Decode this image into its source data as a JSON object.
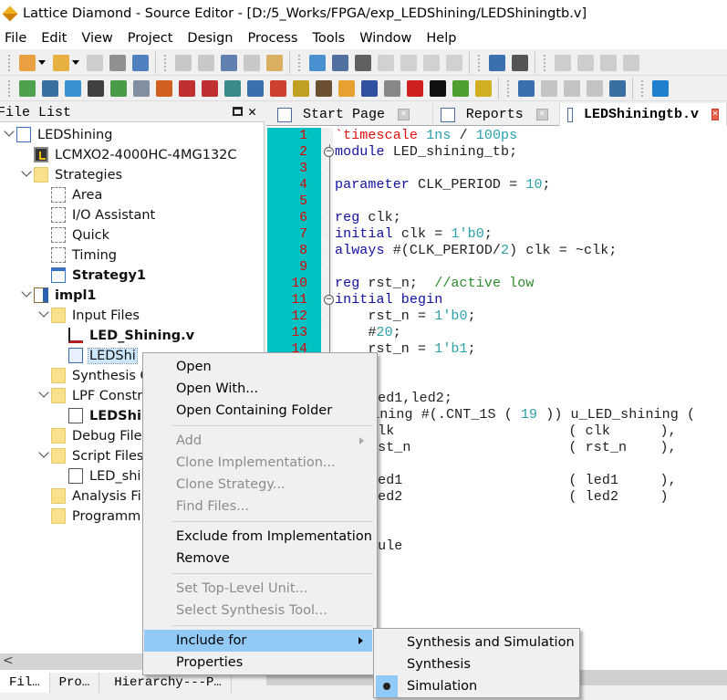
{
  "window": {
    "title": "Lattice Diamond - Source Editor - [D:/5_Works/FPGA/exp_LEDShining/LEDShiningtb.v]"
  },
  "menubar": [
    "File",
    "Edit",
    "View",
    "Project",
    "Design",
    "Process",
    "Tools",
    "Window",
    "Help"
  ],
  "toolbar1": [
    [
      "new-file-icon|#e8a040",
      "dropdown",
      "open-folder-icon|#e8b040",
      "dropdown",
      "save-icon|#b0b0b0",
      "save-all-icon|#909090",
      "print-icon|#5080c0"
    ],
    [
      "undo-icon|#a8a8a8",
      "redo-icon|#a8a8a8",
      "cut-icon|#6080b0",
      "copy-icon|#c8c8c8",
      "paste-icon|#d8b060"
    ],
    [
      "start-page-icon|#4a90d0",
      "report-icon|#5070a0",
      "find-icon|#606060",
      "zoom-in-icon|#b8b8b8",
      "zoom-out-icon|#b8b8b8",
      "zoom-fit-icon|#b8b8b8",
      "zoom-area-icon|#b8b8b8"
    ],
    [
      "strategy-icon|#3a70b0",
      "device-icon|#555555"
    ],
    [
      "run-icon|#b0b0b0",
      "rerun-icon|#b0b0b0",
      "rerun-all-icon|#b0b0b0",
      "stop-icon|#b0b0b0"
    ]
  ],
  "toolbar2": [
    [
      "edit-star-icon|#50a050",
      "spreadsheet-icon|#3a70a0",
      "chip-icon|#3a90d0",
      "netlist-analyzer-icon|#404040",
      "floorplan-icon|#4a9a4a",
      "package-icon|#8090a0",
      "physical-view-icon|#d06020",
      "waveform-icon|#c03030",
      "reveal-icon|#c03030",
      "ipexpress-icon|#3a8a8a",
      "timing-icon|#3a70b0",
      "power-icon|#d04030",
      "simulation-icon|#c0a020",
      "chip-brown-icon|#6a5030",
      "programmer-icon|#e8a030",
      "synplify-icon|#3050a0",
      "tools-icon|#888888",
      "sync-icon|#d02020",
      "modelsim-icon|#101010",
      "run-gear-icon|#50a030",
      "reveal-analyzer-icon|#d0b020"
    ],
    [
      "add-pane-icon|#3a70b0",
      "split-icon|#a0a0a0",
      "next-pane-icon|#a0a0a0",
      "swap-icon|#a0a0a0",
      "merge-icon|#3a70a0"
    ],
    [
      "web-icon|#2080d0"
    ]
  ],
  "filelist": {
    "title": "File List",
    "rows": [
      {
        "label": "LEDShining",
        "level": 0,
        "icon": "project",
        "expanded": true
      },
      {
        "label": "LCMXO2-4000HC-4MG132C",
        "level": 1,
        "icon": "device"
      },
      {
        "label": "Strategies",
        "level": 1,
        "icon": "folder",
        "expanded": true
      },
      {
        "label": "Area",
        "level": 2,
        "icon": "strategy"
      },
      {
        "label": "I/O Assistant",
        "level": 2,
        "icon": "strategy"
      },
      {
        "label": "Quick",
        "level": 2,
        "icon": "strategy"
      },
      {
        "label": "Timing",
        "level": 2,
        "icon": "strategy"
      },
      {
        "label": "Strategy1",
        "level": 2,
        "icon": "strategy-active",
        "bold": true
      },
      {
        "label": "impl1",
        "level": 1,
        "icon": "impl",
        "bold": true,
        "expanded": true
      },
      {
        "label": "Input Files",
        "level": 2,
        "icon": "folder",
        "expanded": true
      },
      {
        "label": "LED_Shining.v",
        "level": 3,
        "icon": "verilog",
        "bold": true
      },
      {
        "label": "LEDShi",
        "level": 3,
        "icon": "waveform",
        "selected": true
      },
      {
        "label": "Synthesis C",
        "level": 2,
        "icon": "folder"
      },
      {
        "label": "LPF Constr",
        "level": 2,
        "icon": "folder",
        "expanded": true
      },
      {
        "label": "LEDShi",
        "level": 3,
        "icon": "doc",
        "bold": true
      },
      {
        "label": "Debug File",
        "level": 2,
        "icon": "folder"
      },
      {
        "label": "Script Files",
        "level": 2,
        "icon": "folder",
        "expanded": true
      },
      {
        "label": "LED_shi",
        "level": 3,
        "icon": "doc"
      },
      {
        "label": "Analysis Fil",
        "level": 2,
        "icon": "folder"
      },
      {
        "label": "Programm",
        "level": 2,
        "icon": "folder"
      }
    ],
    "bottom_tabs": [
      "Fil…",
      "Pro…",
      "Hierarchy---P…"
    ]
  },
  "editor": {
    "tabs": [
      {
        "label": "Start Page",
        "icon": "start-page-icon",
        "active": false
      },
      {
        "label": "Reports",
        "icon": "report-icon",
        "active": false
      },
      {
        "label": "LEDShiningtb.v",
        "icon": "edit-file-icon",
        "active": true
      }
    ],
    "line_numbers": [
      "1",
      "2",
      "3",
      "4",
      "5",
      "6",
      "7",
      "8",
      "9",
      "10",
      "11",
      "12",
      "13",
      "14"
    ],
    "folds": [
      2,
      11
    ],
    "lines": [
      [
        [
          "dir",
          "`timescale "
        ],
        [
          "num",
          "1ns"
        ],
        [
          "id",
          " / "
        ],
        [
          "num",
          "100ps"
        ]
      ],
      [
        [
          "kw",
          "module"
        ],
        [
          "id",
          " LED_shining_tb;"
        ]
      ],
      [],
      [
        [
          "kw",
          "parameter"
        ],
        [
          "id",
          " CLK_PERIOD = "
        ],
        [
          "num",
          "10"
        ],
        [
          "id",
          ";"
        ]
      ],
      [],
      [
        [
          "kw",
          "reg"
        ],
        [
          "id",
          " clk;"
        ]
      ],
      [
        [
          "kw",
          "initial"
        ],
        [
          "id",
          " clk = "
        ],
        [
          "num",
          "1'b0"
        ],
        [
          "id",
          ";"
        ]
      ],
      [
        [
          "kw",
          "always"
        ],
        [
          "id",
          " #(CLK_PERIOD/"
        ],
        [
          "num",
          "2"
        ],
        [
          "id",
          ") clk = ~clk;"
        ]
      ],
      [],
      [
        [
          "kw",
          "reg"
        ],
        [
          "id",
          " rst_n;  "
        ],
        [
          "cm",
          "//active low"
        ]
      ],
      [
        [
          "kw",
          "initial begin"
        ]
      ],
      [
        [
          "id",
          "    rst_n = "
        ],
        [
          "num",
          "1'b0"
        ],
        [
          "id",
          ";"
        ]
      ],
      [
        [
          "id",
          "    #"
        ],
        [
          "num",
          "20"
        ],
        [
          "id",
          ";"
        ]
      ],
      [
        [
          "id",
          "    rst_n = "
        ],
        [
          "num",
          "1'b1"
        ],
        [
          "id",
          ";"
        ]
      ]
    ],
    "partial_lines": [
      {
        "line": 17,
        "segs": [
          [
            "id",
            "led1,led2;"
          ]
        ]
      },
      {
        "line": 18,
        "segs": [
          [
            "id",
            "hining #(.CNT_1S ( "
          ],
          [
            "num",
            "19"
          ],
          [
            "id",
            " )) u_LED_shining ("
          ]
        ]
      },
      {
        "line": 19,
        "segs": [
          [
            "id",
            "clk                     ( clk      ),"
          ]
        ]
      },
      {
        "line": 20,
        "segs": [
          [
            "id",
            "rst_n                   ( rst_n    ),"
          ]
        ]
      },
      {
        "line": 22,
        "segs": [
          [
            "id",
            "led1                    ( led1     ),"
          ]
        ]
      },
      {
        "line": 23,
        "segs": [
          [
            "id",
            "led2                    ( led2     )"
          ]
        ]
      },
      {
        "line": 26,
        "segs": [
          [
            "id",
            "dule"
          ]
        ]
      }
    ]
  },
  "context_menu": {
    "items": [
      {
        "label": "Open"
      },
      {
        "label": "Open With..."
      },
      {
        "label": "Open Containing Folder"
      },
      {
        "sep": true
      },
      {
        "label": "Add",
        "disabled": true,
        "submenu": true
      },
      {
        "label": "Clone Implementation...",
        "disabled": true
      },
      {
        "label": "Clone Strategy...",
        "disabled": true
      },
      {
        "label": "Find Files...",
        "disabled": true
      },
      {
        "sep": true
      },
      {
        "label": "Exclude from Implementation"
      },
      {
        "label": "Remove"
      },
      {
        "sep": true
      },
      {
        "label": "Set Top-Level Unit...",
        "disabled": true
      },
      {
        "label": "Select Synthesis Tool...",
        "disabled": true
      },
      {
        "sep": true
      },
      {
        "label": "Include for",
        "submenu": true,
        "highlighted": true
      },
      {
        "label": "Properties"
      }
    ],
    "include_for_submenu": [
      {
        "label": "Synthesis and Simulation",
        "checked": false
      },
      {
        "label": "Synthesis",
        "checked": false
      },
      {
        "label": "Simulation",
        "checked": true
      }
    ]
  },
  "colors": {
    "gutter": "#00c2c2",
    "line_number": "#e00000",
    "keyword": "#1010a0",
    "number": "#2aa0a8",
    "comment": "#2c8c2c",
    "menu_highlight": "#91c9f7"
  }
}
